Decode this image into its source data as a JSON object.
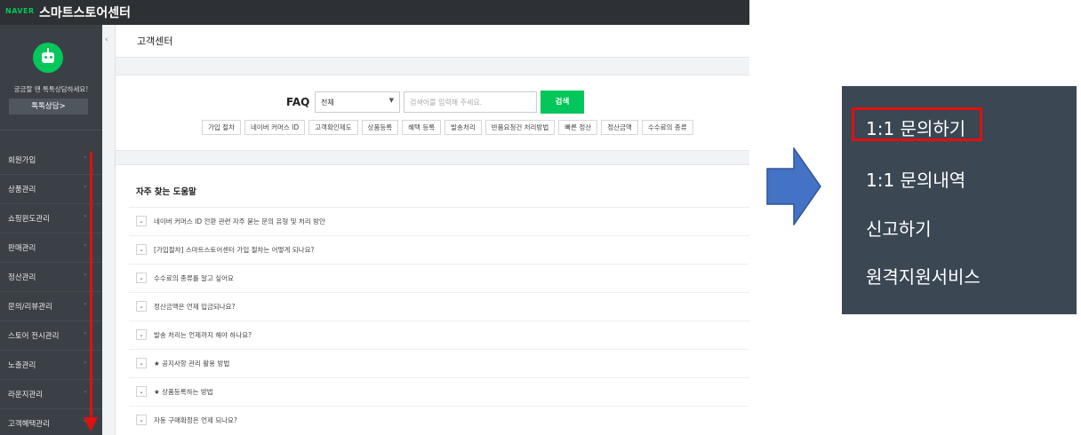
{
  "app": {
    "brand": "NAVER",
    "title": "스마트스토어센터"
  },
  "sidebar": {
    "bot_text": "궁금할 땐 톡톡상담하세요!",
    "chat_button": "톡톡상담>",
    "items": [
      {
        "label": "회원가입"
      },
      {
        "label": "상품관리"
      },
      {
        "label": "쇼핑윈도관리"
      },
      {
        "label": "판매관리"
      },
      {
        "label": "정산관리"
      },
      {
        "label": "문의/리뷰관리"
      },
      {
        "label": "스토어 전시관리"
      },
      {
        "label": "노출관리"
      },
      {
        "label": "라운지관리"
      },
      {
        "label": "고객혜택관리"
      }
    ]
  },
  "page": {
    "title": "고객센터"
  },
  "faq": {
    "label": "FAQ",
    "select_value": "전체",
    "search_placeholder": "검색어를 입력해 주세요.",
    "search_button": "검색",
    "tags": [
      "가입 절차",
      "네이버 커머스 ID",
      "고객확인제도",
      "상품등록",
      "혜택 등록",
      "발송처리",
      "반품요청건 처리방법",
      "빠른 정산",
      "정산금액",
      "수수료의 종류"
    ]
  },
  "help": {
    "title": "자주 찾는 도움말",
    "questions": [
      "네이버 커머스 ID 전환 관련 자주 묻는 문의 유형 및 처리 방안",
      "[가입절차] 스마트스토어센터 가입 절차는 어떻게 되나요?",
      "수수료의 종류를 알고 싶어요",
      "정산금액은 언제 입금되나요?",
      "발송 처리는 언제까지 해야 하나요?",
      "★ 공지사항 관리 활용 방법",
      "★ 상품등록하는 방법",
      "자동 구매확정은 언제 되나요?"
    ]
  },
  "menu": {
    "items": [
      "1:1 문의하기",
      "1:1 문의내역",
      "신고하기",
      "원격지원서비스"
    ]
  },
  "colors": {
    "naver_green": "#03c75a",
    "sidebar_bg": "#3b4046",
    "topbar_bg": "#2d3034",
    "menu_bg": "#3b4753",
    "highlight_red": "#e01010",
    "arrow_blue": "#4472c4"
  },
  "icons": {
    "bot": "chatbot-icon",
    "collapse": "chevron-left-icon",
    "nav_chevron": "chevron-down-icon",
    "select_caret": "caret-down-icon",
    "row_toggle": "chevron-down-icon"
  }
}
